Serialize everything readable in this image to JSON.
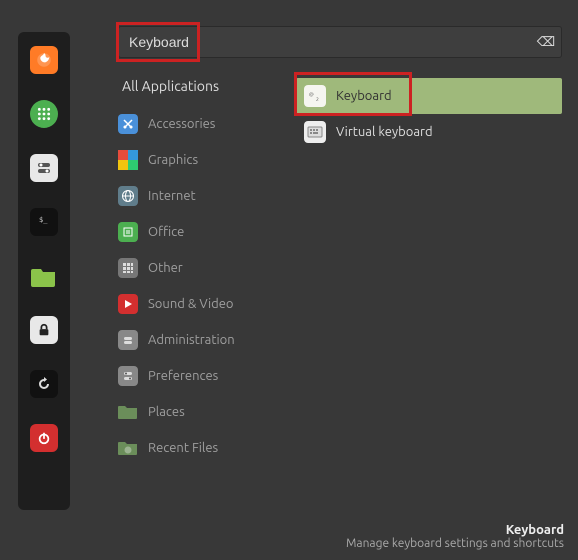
{
  "search": {
    "value": "Keyboard",
    "clear_glyph": "⌫"
  },
  "all_apps_label": "All Applications",
  "categories": [
    {
      "label": "Accessories"
    },
    {
      "label": "Graphics"
    },
    {
      "label": "Internet"
    },
    {
      "label": "Office"
    },
    {
      "label": "Other"
    },
    {
      "label": "Sound & Video"
    },
    {
      "label": "Administration"
    },
    {
      "label": "Preferences"
    },
    {
      "label": "Places"
    },
    {
      "label": "Recent Files"
    }
  ],
  "results": {
    "keyboard": "Keyboard",
    "virtual_keyboard": "Virtual keyboard"
  },
  "footer": {
    "title": "Keyboard",
    "desc": "Manage keyboard settings and shortcuts"
  }
}
